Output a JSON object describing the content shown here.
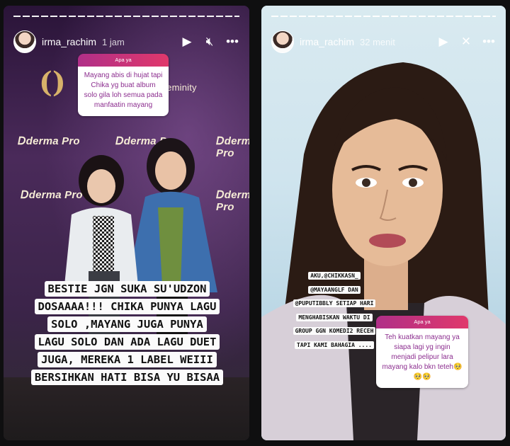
{
  "left_story": {
    "username": "irma_rachim",
    "time": "1 jam",
    "icons": [
      "play-icon",
      "mute-icon",
      "more-icon"
    ],
    "question": {
      "title": "Apa ya",
      "text": "Mayang abis di hujat tapi Chika yg buat album solo gila loh semua pada manfaatin mayang"
    },
    "caption_lines": [
      "BESTIE JGN SUKA SU'UDZON",
      "DOSAAAA!!! CHIKA PUNYA  LAGU",
      "SOLO ,MAYANG JUGA PUNYA",
      "LAGU SOLO DAN ADA LAGU DUET",
      "JUGA, MEREKA 1 LABEL WEIII",
      "BERSIHKAN HATI BISA YU BISAA"
    ],
    "background_brand": "derma Pro",
    "brand_tagline": "Feminity"
  },
  "right_story": {
    "username": "irma_rachim",
    "time": "32 menit",
    "icons": [
      "play-icon",
      "mute-icon",
      "more-icon"
    ],
    "caption_lines": [
      "AKU,@CHIKKASN_",
      "@MAYAANGLF DAN",
      "@PUPUTIBBLY SETIAP HARI",
      "MENGHABISKAN WAKTU DI",
      "GROUP GGN KOMEDI2 RECEH",
      "TAPI KAMI BAHAGIA ...."
    ],
    "question": {
      "title": "Apa ya",
      "text": "Teh kuatkan mayang ya siapa lagi yg ingin menjadi pelipur lara mayang kalo bkn teteh🥺🥺🥺"
    }
  },
  "colors": {
    "sticker_gradient_start": "#b02f88",
    "sticker_gradient_end": "#e0386b",
    "sticker_text": "#8c2e8f"
  }
}
